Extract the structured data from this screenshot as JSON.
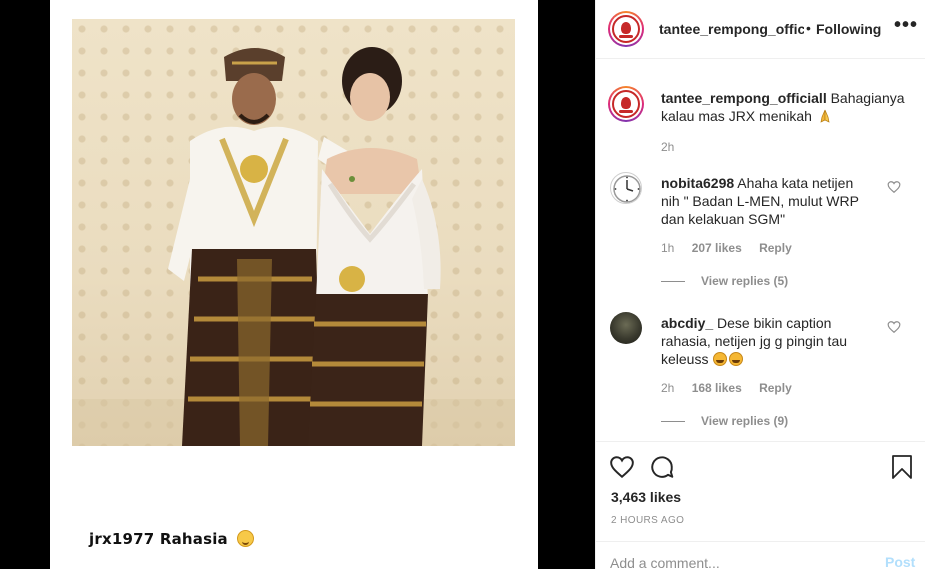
{
  "post": {
    "caption_user": "jrx1977",
    "caption_text": "Rahasia"
  },
  "header": {
    "username": "tantee_rempong_officiall",
    "separator": "•",
    "follow_status": "Following",
    "more": "•••"
  },
  "comments": [
    {
      "username": "tantee_rempong_officiall",
      "text": "Bahagianya kalau mas JRX menikah",
      "time": "2h"
    },
    {
      "username": "nobita6298",
      "text": "Ahaha kata netijen nih \" Badan L-MEN, mulut WRP dan kelakuan SGM\"",
      "time": "1h",
      "likes": "207 likes",
      "reply": "Reply",
      "view_replies": "View replies (5)"
    },
    {
      "username": "abcdiy_",
      "text": "Dese bikin caption rahasia, netijen jg g pingin tau keleuss",
      "time": "2h",
      "likes": "168 likes",
      "reply": "Reply",
      "view_replies": "View replies (9)"
    }
  ],
  "actions": {
    "likes": "3,463 likes",
    "time_ago": "2 HOURS AGO"
  },
  "add_comment": {
    "placeholder": "Add a comment...",
    "post_label": "Post"
  },
  "colors": {
    "link_blue_disabled": "#b2dffc",
    "secondary_text": "#8e8e8e",
    "primary_text": "#262626"
  }
}
